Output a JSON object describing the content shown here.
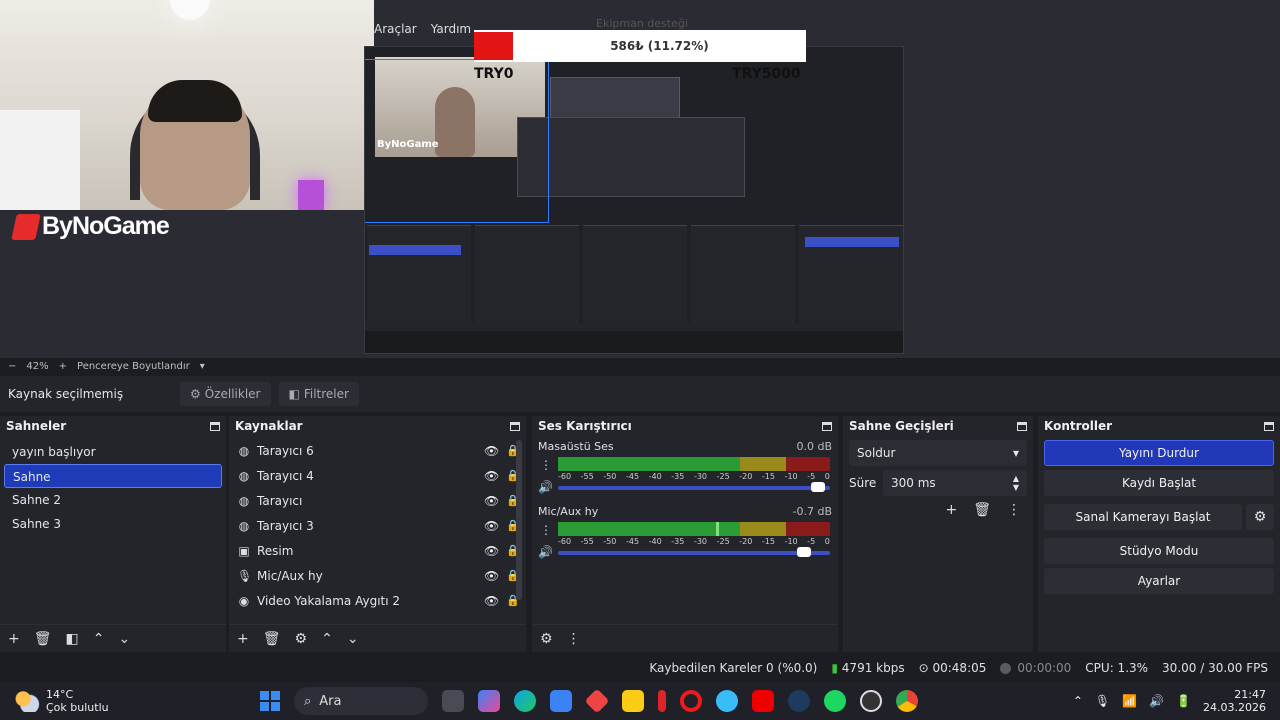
{
  "window": {
    "minimize": "─",
    "maximize": "☐",
    "close": "✕"
  },
  "preview": {
    "menu": [
      "Araçlar",
      "Yardım"
    ],
    "logo_text": "ByNoGame",
    "donation": {
      "title": "Ekipman desteği",
      "text": "586₺ (11.72%)",
      "progress_fraction": 0.1172,
      "min": "TRY0",
      "max": "TRY5000"
    }
  },
  "zoom": {
    "minus": "−",
    "level": "42%",
    "plus": "+",
    "fit_label": "Pencereye Boyutlandır"
  },
  "context": {
    "source_label": "Kaynak seçilmemiş",
    "properties": "Özellikler",
    "filters": "Filtreler"
  },
  "scenes": {
    "title": "Sahneler",
    "items": [
      "yayın başlıyor",
      "Sahne",
      "Sahne 2",
      "Sahne 3"
    ],
    "selected_index": 1
  },
  "sources": {
    "title": "Kaynaklar",
    "items": [
      {
        "label": "Tarayıcı 6",
        "icon": "globe-icon"
      },
      {
        "label": "Tarayıcı 4",
        "icon": "globe-icon"
      },
      {
        "label": "Tarayıcı",
        "icon": "globe-icon"
      },
      {
        "label": "Tarayıcı 3",
        "icon": "globe-icon"
      },
      {
        "label": "Resim",
        "icon": "image-icon"
      },
      {
        "label": "Mic/Aux hy",
        "icon": "mic-icon"
      },
      {
        "label": "Video Yakalama Aygıtı 2",
        "icon": "camera-icon"
      }
    ]
  },
  "mixer": {
    "title": "Ses Karıştırıcı",
    "ticks": [
      "-60",
      "-55",
      "-50",
      "-45",
      "-40",
      "-35",
      "-30",
      "-25",
      "-20",
      "-15",
      "-10",
      "-5",
      "0"
    ],
    "channels": [
      {
        "name": "Masaüstü Ses",
        "db": "0.0 dB",
        "volume_fraction": 0.98
      },
      {
        "name": "Mic/Aux hy",
        "db": "-0.7 dB",
        "volume_fraction": 0.93,
        "level_fraction": 0.58
      }
    ]
  },
  "transitions": {
    "title": "Sahne Geçişleri",
    "selected": "Soldur",
    "duration_label": "Süre",
    "duration_value": "300 ms"
  },
  "controls": {
    "title": "Kontroller",
    "stop_stream": "Yayını Durdur",
    "start_recording": "Kaydı Başlat",
    "start_virtualcam": "Sanal Kamerayı Başlat",
    "studio_mode": "Stüdyo Modu",
    "settings": "Ayarlar"
  },
  "status": {
    "dropped_frames": "Kaybedilen Kareler 0 (%0.0)",
    "bitrate": "4791 kbps",
    "stream_time": "00:48:05",
    "rec_time": "00:00:00",
    "cpu": "CPU: 1.3%",
    "fps": "30.00 / 30.00 FPS"
  },
  "taskbar": {
    "weather_temp": "14°C",
    "weather_desc": "Çok bulutlu",
    "search_placeholder": "Ara",
    "time": "21:47",
    "date": "24.03.2026",
    "apps": [
      "file-explorer",
      "copilot",
      "edge",
      "store",
      "red-app",
      "folder",
      "red-app-2",
      "opera",
      "chrome-alt",
      "youtube",
      "steam",
      "spotify",
      "obs",
      "chrome"
    ]
  },
  "colors": {
    "accent": "#2139b8",
    "selected_scene": "#1e3bb8",
    "meter_green": "#2b9b35",
    "meter_yellow": "#9a8a1a",
    "meter_red": "#8a1b1b"
  }
}
